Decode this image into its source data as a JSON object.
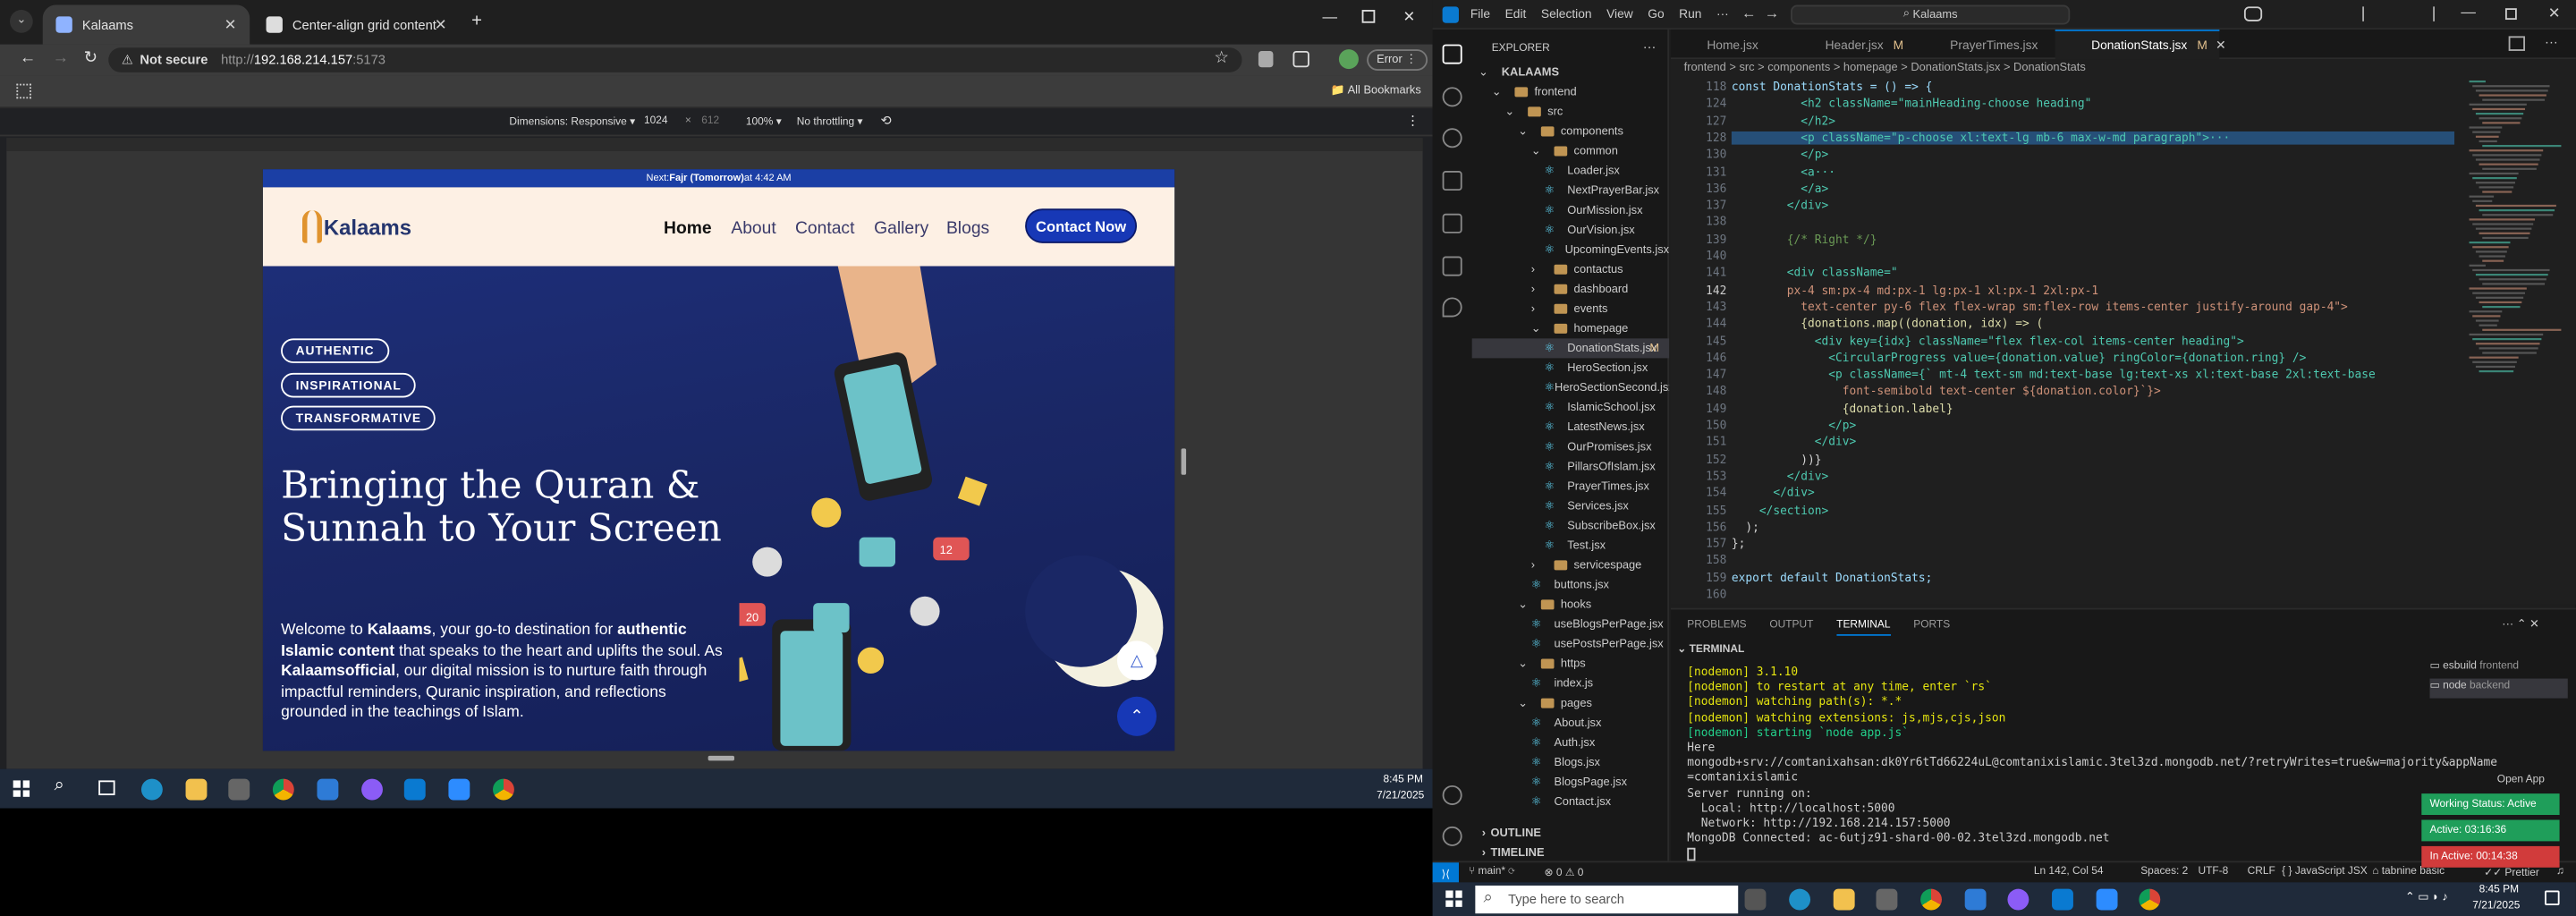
{
  "chrome": {
    "tabs": [
      {
        "label": "Kalaams",
        "active": true
      },
      {
        "label": "Center-align grid content",
        "active": false
      }
    ],
    "not_secure": "Not secure",
    "url_prefix": "http://",
    "url_host": "192.168.214.157",
    "url_port": ":5173",
    "error_label": "Error",
    "all_bookmarks": "All Bookmarks",
    "devtools": {
      "dimensions": "Dimensions: Responsive",
      "width": "1024",
      "times": "×",
      "height": "612",
      "zoom": "100%",
      "throttling": "No throttling"
    }
  },
  "site": {
    "prayer_prefix": "Next: ",
    "prayer_name": "Fajr (Tomorrow)",
    "prayer_time": " at 4:42 AM",
    "logo_text": "Kalaams",
    "nav": [
      "Home",
      "About",
      "Contact",
      "Gallery",
      "Blogs"
    ],
    "contact_button": "Contact Now",
    "pills": [
      "AUTHENTIC",
      "INSPIRATIONAL",
      "TRANSFORMATIVE"
    ],
    "hero_title": "Bringing the Quran & Sunnah to Your Screen",
    "hero_p1": "Welcome to ",
    "hero_b1": "Kalaams",
    "hero_p2": ", your go-to destination for ",
    "hero_b2": "authentic Islamic content",
    "hero_p3": " that speaks to the heart and uplifts the soul. As ",
    "hero_b3": "Kalaamsofficial",
    "hero_p4": ", our digital mission is to nurture faith through impactful reminders, Quranic inspiration, and reflections grounded in the teachings of Islam.",
    "notif_badge_1": "20",
    "notif_badge_2": "12"
  },
  "taskbar_left": {
    "time": "8:45 PM",
    "date": "7/21/2025"
  },
  "vscode": {
    "menu": [
      "File",
      "Edit",
      "Selection",
      "View",
      "Go",
      "Run",
      "···"
    ],
    "command_center": "Kalaams",
    "explorer_title": "EXPLORER",
    "tree": [
      {
        "label": "KALAAMS",
        "indent": 0,
        "type": "root"
      },
      {
        "label": "frontend",
        "indent": 1,
        "type": "open"
      },
      {
        "label": "src",
        "indent": 2,
        "type": "open"
      },
      {
        "label": "components",
        "indent": 3,
        "type": "open"
      },
      {
        "label": "common",
        "indent": 4,
        "type": "open"
      },
      {
        "label": "Loader.jsx",
        "indent": 5,
        "type": "file"
      },
      {
        "label": "NextPrayerBar.jsx",
        "indent": 5,
        "type": "file"
      },
      {
        "label": "OurMission.jsx",
        "indent": 5,
        "type": "file"
      },
      {
        "label": "OurVision.jsx",
        "indent": 5,
        "type": "file"
      },
      {
        "label": "UpcomingEvents.jsx",
        "indent": 5,
        "type": "file"
      },
      {
        "label": "contactus",
        "indent": 4,
        "type": "closed"
      },
      {
        "label": "dashboard",
        "indent": 4,
        "type": "closed"
      },
      {
        "label": "events",
        "indent": 4,
        "type": "closed"
      },
      {
        "label": "homepage",
        "indent": 4,
        "type": "open"
      },
      {
        "label": "DonationStats.jsx",
        "indent": 5,
        "type": "file",
        "mod": "M",
        "selected": true
      },
      {
        "label": "HeroSection.jsx",
        "indent": 5,
        "type": "file"
      },
      {
        "label": "HeroSectionSecond.jsx",
        "indent": 5,
        "type": "file"
      },
      {
        "label": "IslamicSchool.jsx",
        "indent": 5,
        "type": "file"
      },
      {
        "label": "LatestNews.jsx",
        "indent": 5,
        "type": "file"
      },
      {
        "label": "OurPromises.jsx",
        "indent": 5,
        "type": "file"
      },
      {
        "label": "PillarsOfIslam.jsx",
        "indent": 5,
        "type": "file"
      },
      {
        "label": "PrayerTimes.jsx",
        "indent": 5,
        "type": "file"
      },
      {
        "label": "Services.jsx",
        "indent": 5,
        "type": "file"
      },
      {
        "label": "SubscribeBox.jsx",
        "indent": 5,
        "type": "file"
      },
      {
        "label": "Test.jsx",
        "indent": 5,
        "type": "file"
      },
      {
        "label": "servicespage",
        "indent": 4,
        "type": "closed"
      },
      {
        "label": "buttons.jsx",
        "indent": 4,
        "type": "file"
      },
      {
        "label": "hooks",
        "indent": 3,
        "type": "open"
      },
      {
        "label": "useBlogsPerPage.jsx",
        "indent": 4,
        "type": "file"
      },
      {
        "label": "usePostsPerPage.jsx",
        "indent": 4,
        "type": "file"
      },
      {
        "label": "https",
        "indent": 3,
        "type": "open"
      },
      {
        "label": "index.js",
        "indent": 4,
        "type": "file"
      },
      {
        "label": "pages",
        "indent": 3,
        "type": "open"
      },
      {
        "label": "About.jsx",
        "indent": 4,
        "type": "file"
      },
      {
        "label": "Auth.jsx",
        "indent": 4,
        "type": "file"
      },
      {
        "label": "Blogs.jsx",
        "indent": 4,
        "type": "file"
      },
      {
        "label": "BlogsPage.jsx",
        "indent": 4,
        "type": "file"
      },
      {
        "label": "Contact.jsx",
        "indent": 4,
        "type": "file"
      }
    ],
    "outline": "OUTLINE",
    "timeline": "TIMELINE",
    "editor_tabs": [
      {
        "label": "Home.jsx",
        "mod": ""
      },
      {
        "label": "Header.jsx",
        "mod": "M"
      },
      {
        "label": "PrayerTimes.jsx",
        "mod": ""
      },
      {
        "label": "DonationStats.jsx",
        "mod": "M",
        "active": true
      }
    ],
    "breadcrumbs": "frontend > src > components > homepage > DonationStats.jsx > DonationStats",
    "code_lines": [
      {
        "n": "118",
        "t": "const DonationStats = () => {"
      },
      {
        "n": "124",
        "t": "          <h2 className=\"mainHeading-choose heading\""
      },
      {
        "n": "127",
        "t": "          </h2>"
      },
      {
        "n": "128",
        "t": "          <p className=\"p-choose xl:text-lg mb-6 max-w-md paragraph\">···"
      },
      {
        "n": "130",
        "t": "          </p>"
      },
      {
        "n": "131",
        "t": "          <a···"
      },
      {
        "n": "136",
        "t": "          </a>"
      },
      {
        "n": "137",
        "t": "        </div>"
      },
      {
        "n": "138",
        "t": ""
      },
      {
        "n": "139",
        "t": "        {/* Right */}"
      },
      {
        "n": "140",
        "t": ""
      },
      {
        "n": "141",
        "t": "        <div className=\""
      },
      {
        "n": "142",
        "t": "        px-4 sm:px-4 md:px-1 lg:px-1 xl:px-1 2xl:px-1"
      },
      {
        "n": "143",
        "t": "          text-center py-6 flex flex-wrap sm:flex-row items-center justify-around gap-4\">"
      },
      {
        "n": "144",
        "t": "          {donations.map((donation, idx) => ("
      },
      {
        "n": "145",
        "t": "            <div key={idx} className=\"flex flex-col items-center heading\">"
      },
      {
        "n": "146",
        "t": "              <CircularProgress value={donation.value} ringColor={donation.ring} />"
      },
      {
        "n": "147",
        "t": "              <p className={` mt-4 text-sm md:text-base lg:text-xs xl:text-base 2xl:text-base"
      },
      {
        "n": "148",
        "t": "                font-semibold text-center ${donation.color}`}>"
      },
      {
        "n": "149",
        "t": "                {donation.label}"
      },
      {
        "n": "150",
        "t": "              </p>"
      },
      {
        "n": "151",
        "t": "            </div>"
      },
      {
        "n": "152",
        "t": "          ))}"
      },
      {
        "n": "153",
        "t": "        </div>"
      },
      {
        "n": "154",
        "t": "      </div>"
      },
      {
        "n": "155",
        "t": "    </section>"
      },
      {
        "n": "156",
        "t": "  );"
      },
      {
        "n": "157",
        "t": "};"
      },
      {
        "n": "158",
        "t": ""
      },
      {
        "n": "159",
        "t": "export default DonationStats;"
      },
      {
        "n": "160",
        "t": ""
      }
    ],
    "panel_tabs": [
      "PROBLEMS",
      "OUTPUT",
      "TERMINAL",
      "PORTS"
    ],
    "terminal_title": "TERMINAL",
    "terminal_lines": [
      "[nodemon] 3.1.10",
      "[nodemon] to restart at any time, enter `rs`",
      "[nodemon] watching path(s): *.*",
      "[nodemon] watching extensions: js,mjs,cjs,json",
      "[nodemon] starting `node app.js`",
      "Here",
      "mongodb+srv://comtanixahsan:dk0Yr6tTd66224uL@comtanixislamic.3tel3zd.mongodb.net/?retryWrites=true&w=majority&appName",
      "=comtanixislamic",
      "Server running on:",
      "  Local: http://localhost:5000",
      "  Network: http://192.168.214.157:5000",
      "MongoDB Connected: ac-6utjz91-shard-00-02.3tel3zd.mongodb.net"
    ],
    "terminals": [
      {
        "label": "esbuild",
        "sub": "frontend"
      },
      {
        "label": "node",
        "sub": "backend"
      }
    ],
    "open_app": "Open App",
    "working_status": "Working Status: Active",
    "active_time": "Active: 03:16:36",
    "inactive_time": "In Active: 00:14:38",
    "status": {
      "branch": "main*",
      "problems": "⊗ 0 ⚠ 0",
      "position": "Ln 142, Col 54",
      "spaces": "Spaces: 2",
      "encoding": "UTF-8",
      "eol": "CRLF",
      "lang": "JavaScript JSX",
      "tabnine": "tabnine basic",
      "prettier": "Prettier"
    }
  },
  "taskbar_right": {
    "search_placeholder": "Type here to search",
    "time": "8:45 PM",
    "date": "7/21/2025"
  },
  "colors": {
    "accent": "#0078d4",
    "site_blue": "#1738b6",
    "nav_bg": "#fdf0e4"
  }
}
